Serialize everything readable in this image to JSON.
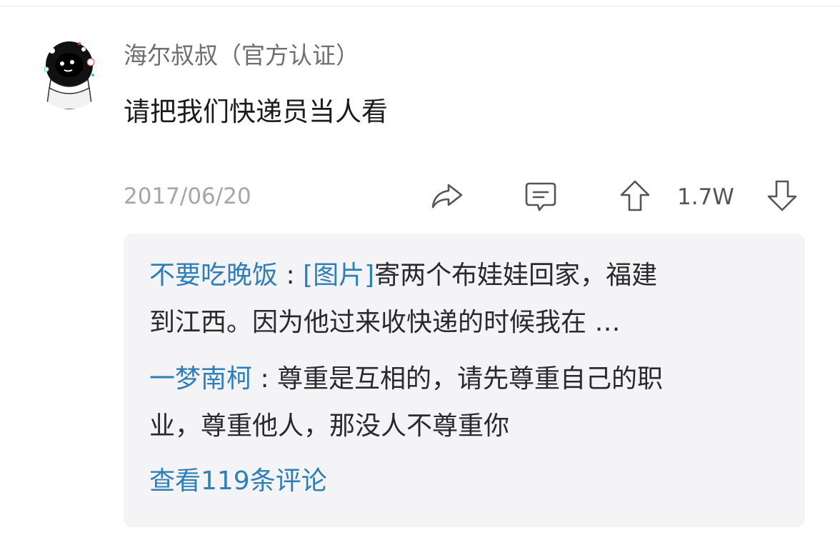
{
  "comment": {
    "username": "海尔叔叔（官方认证）",
    "content": "请把我们快递员当人看",
    "date": "2017/06/20",
    "likes": "1.7W",
    "icons": {
      "avatar": "astronaut-avatar-icon",
      "share": "share-icon",
      "reply": "comment-bubble-icon",
      "upvote": "upvote-arrow-icon",
      "downvote": "downvote-arrow-icon"
    }
  },
  "replies": [
    {
      "author": "不要吃晚饭",
      "separator": " : ",
      "tag": "[图片]",
      "text_line1": "寄两个布娃娃回家，福建",
      "text_line2": "到江西。因为他过来收快递的时候我在 …"
    },
    {
      "author": "一梦南柯",
      "separator": " : ",
      "text_line1": "尊重是互相的，请先尊重自己的职",
      "text_line2": "业，尊重他人，那没人不尊重你"
    }
  ],
  "view_more": "查看119条评论",
  "colors": {
    "link_blue": "#2e7fb8",
    "reply_bg": "#f4f4f7",
    "meta_gray": "#a6a6a6"
  }
}
